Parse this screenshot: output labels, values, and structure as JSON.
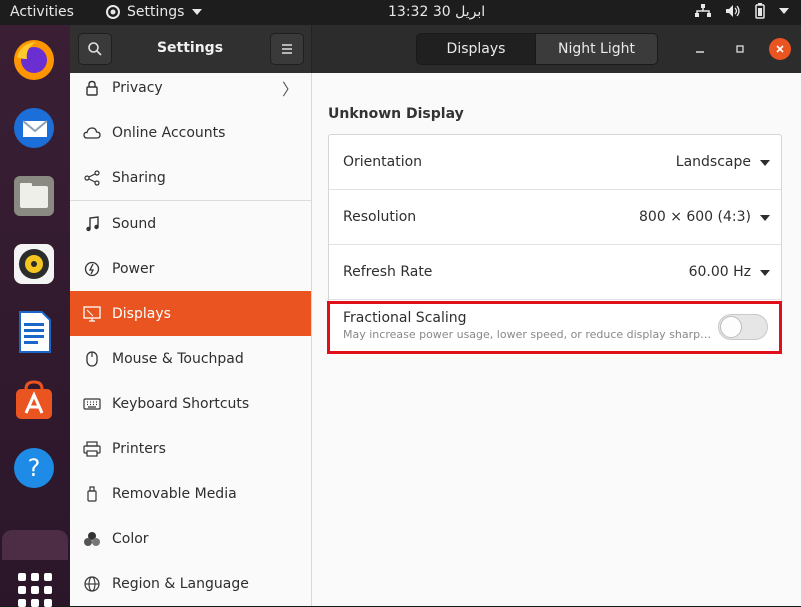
{
  "topbar": {
    "activities_label": "Activities",
    "app_menu_label": "Settings",
    "clock": "ابریل 30 13:32"
  },
  "dock": {
    "items": [
      "firefox",
      "thunderbird",
      "files",
      "rhythmbox",
      "writer",
      "software",
      "help",
      "show-apps"
    ]
  },
  "window": {
    "sidebar_title": "Settings",
    "tabs": [
      {
        "label": "Displays",
        "active": true
      },
      {
        "label": "Night Light",
        "active": false
      }
    ],
    "sidebar_items": [
      {
        "label": "Privacy",
        "icon": "lock-icon",
        "has_chevron": true
      },
      {
        "label": "Online Accounts",
        "icon": "cloud-icon"
      },
      {
        "label": "Sharing",
        "icon": "share-icon"
      },
      {
        "label": "Sound",
        "icon": "music-note-icon"
      },
      {
        "label": "Power",
        "icon": "power-icon"
      },
      {
        "label": "Displays",
        "icon": "display-icon",
        "active": true
      },
      {
        "label": "Mouse & Touchpad",
        "icon": "mouse-icon"
      },
      {
        "label": "Keyboard Shortcuts",
        "icon": "keyboard-icon"
      },
      {
        "label": "Printers",
        "icon": "printer-icon"
      },
      {
        "label": "Removable Media",
        "icon": "usb-icon"
      },
      {
        "label": "Color",
        "icon": "color-icon"
      },
      {
        "label": "Region & Language",
        "icon": "globe-icon"
      }
    ],
    "display": {
      "name": "Unknown Display",
      "rows": [
        {
          "label": "Orientation",
          "value": "Landscape"
        },
        {
          "label": "Resolution",
          "value": "800 × 600 (4:3)"
        },
        {
          "label": "Refresh Rate",
          "value": "60.00 Hz"
        }
      ],
      "fractional_scaling": {
        "title": "Fractional Scaling",
        "description": "May increase power usage, lower speed, or reduce display sharpness.",
        "enabled": false
      }
    }
  },
  "colors": {
    "accent": "#e95420",
    "highlight_box": "#e0101a"
  }
}
